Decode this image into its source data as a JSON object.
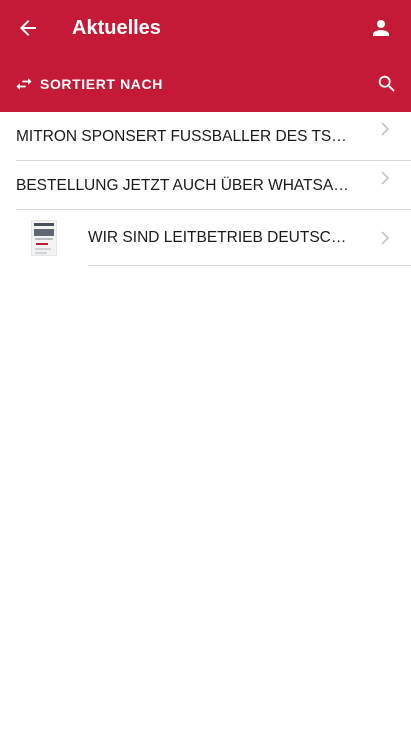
{
  "header": {
    "title": "Aktuelles",
    "back_icon": "arrow-back-icon",
    "account_icon": "person-icon",
    "background": "#c41a38"
  },
  "toolbar": {
    "sort_label": "SORTIERT NACH",
    "sort_icon": "swap-arrows-icon",
    "search_icon": "search-icon"
  },
  "news": {
    "items": [
      {
        "title": "MITRON SPONSERT FUSSBALLER DES TS…"
      },
      {
        "title": "BESTELLUNG JETZT AUCH ÜBER WHATSA…"
      },
      {
        "title": "WIR SIND LEITBETRIEB DEUTSC…",
        "thumbnail": "document-thumbnail"
      }
    ]
  }
}
